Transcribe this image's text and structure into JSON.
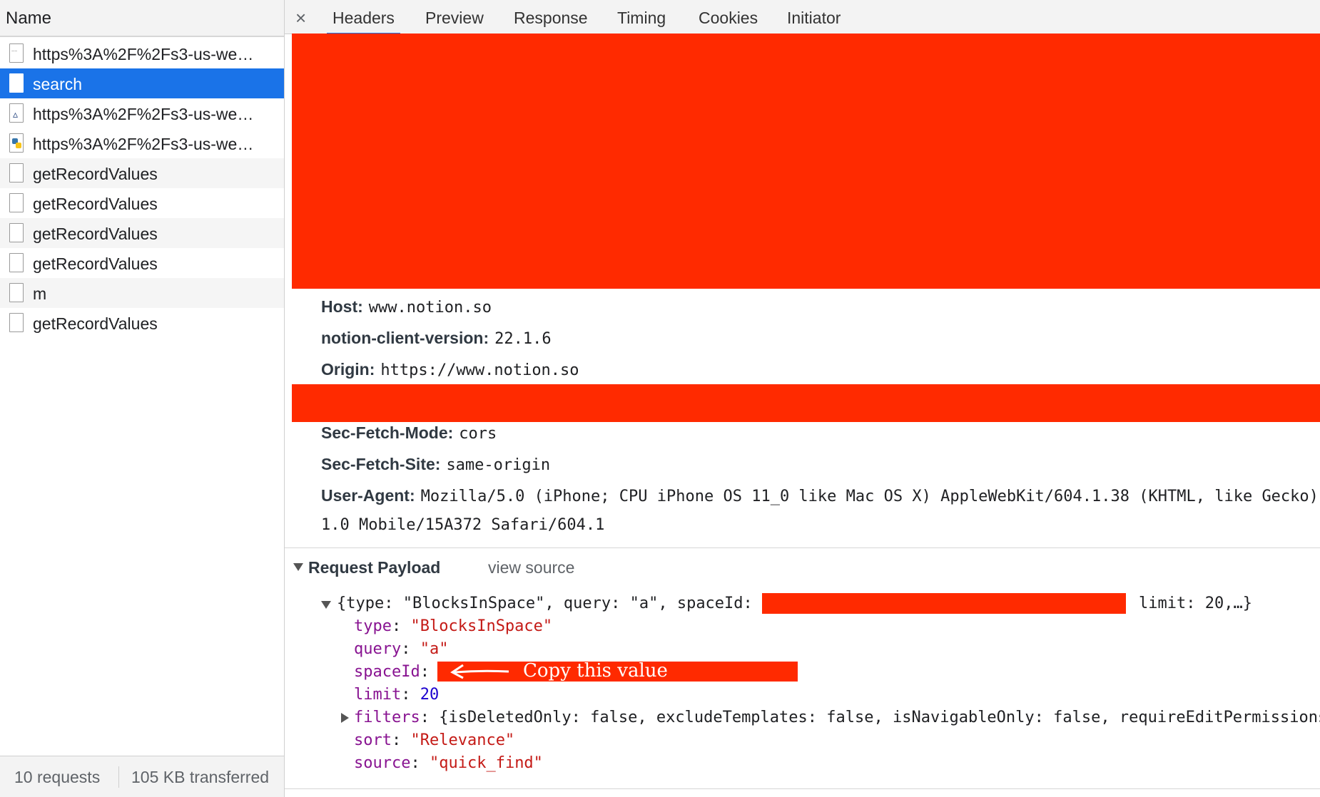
{
  "request_list": {
    "column_header": "Name",
    "items": [
      {
        "label": "https%3A%2F%2Fs3-us-we…",
        "icon": "font-file-icon"
      },
      {
        "label": "search",
        "icon": "document-icon",
        "selected": true
      },
      {
        "label": "https%3A%2F%2Fs3-us-we…",
        "icon": "vector-image-icon"
      },
      {
        "label": "https%3A%2F%2Fs3-us-we…",
        "icon": "python-file-icon"
      },
      {
        "label": "getRecordValues",
        "icon": "document-icon"
      },
      {
        "label": "getRecordValues",
        "icon": "document-icon"
      },
      {
        "label": "getRecordValues",
        "icon": "document-icon"
      },
      {
        "label": "getRecordValues",
        "icon": "document-icon"
      },
      {
        "label": "m",
        "icon": "document-icon"
      },
      {
        "label": "getRecordValues",
        "icon": "document-icon"
      }
    ],
    "footer": {
      "requests": "10 requests",
      "transferred": "105 KB transferred"
    }
  },
  "tabs": {
    "close_symbol": "×",
    "headers": "Headers",
    "preview": "Preview",
    "response": "Response",
    "timing": "Timing",
    "cookies": "Cookies",
    "initiator": "Initiator",
    "active": "Headers"
  },
  "headers": {
    "host": {
      "name": "Host:",
      "value": "www.notion.so"
    },
    "client_version": {
      "name": "notion-client-version:",
      "value": "22.1.6"
    },
    "origin": {
      "name": "Origin:",
      "value": "https://www.notion.so"
    },
    "sec_fetch_mode": {
      "name": "Sec-Fetch-Mode:",
      "value": "cors"
    },
    "sec_fetch_site": {
      "name": "Sec-Fetch-Site:",
      "value": "same-origin"
    },
    "user_agent": {
      "name": "User-Agent:",
      "value": "Mozilla/5.0 (iPhone; CPU iPhone OS 11_0 like Mac OS X) AppleWebKit/604.1.38 (KHTML, like Gecko)",
      "value_cont": "1.0 Mobile/15A372 Safari/604.1"
    }
  },
  "payload": {
    "title": "Request Payload",
    "view_source": "view source",
    "summary_prefix": "{type: \"BlocksInSpace\", query: \"a\", spaceId: ",
    "summary_suffix": "limit: 20,…}",
    "fields": {
      "type_key": "type",
      "type_value": "\"BlocksInSpace\"",
      "query_key": "query",
      "query_value": "\"a\"",
      "spaceid_key": "spaceId",
      "limit_key": "limit",
      "limit_value": "20",
      "filters_key": "filters",
      "filters_value": "{isDeletedOnly: false, excludeTemplates: false, isNavigableOnly: false, requireEditPermissions",
      "sort_key": "sort",
      "sort_value": "\"Relevance\"",
      "source_key": "source",
      "source_value": "\"quick_find\""
    },
    "annotation": "Copy this value"
  },
  "colors": {
    "selection": "#1a73e8",
    "redaction": "#ff2a00",
    "key": "#881391",
    "string": "#c41a16",
    "number": "#1c00cf"
  }
}
